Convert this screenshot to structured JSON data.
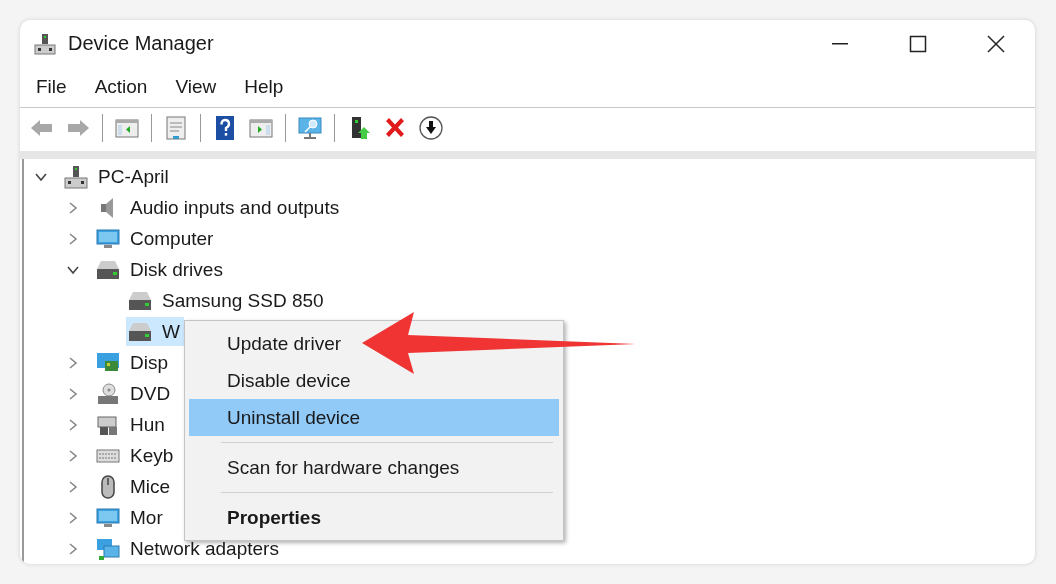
{
  "window": {
    "title": "Device Manager"
  },
  "menu_bar": [
    "File",
    "Action",
    "View",
    "Help"
  ],
  "toolbar": [
    {
      "kind": "back",
      "disabled": true
    },
    {
      "kind": "forward",
      "disabled": true
    },
    {
      "kind": "separator"
    },
    {
      "kind": "panel-left",
      "disabled": false
    },
    {
      "kind": "separator"
    },
    {
      "kind": "properties",
      "disabled": false
    },
    {
      "kind": "separator"
    },
    {
      "kind": "help",
      "disabled": false
    },
    {
      "kind": "panel-right",
      "disabled": false
    },
    {
      "kind": "separator"
    },
    {
      "kind": "scan",
      "disabled": false
    },
    {
      "kind": "separator"
    },
    {
      "kind": "update",
      "disabled": false
    },
    {
      "kind": "uninstall",
      "disabled": false
    },
    {
      "kind": "download",
      "disabled": false
    }
  ],
  "tree": {
    "label": "PC-April",
    "kind": "root",
    "expanded": true,
    "selected": false,
    "children": [
      {
        "label": "Audio inputs and outputs",
        "kind": "audio",
        "expanded": false,
        "selected": false
      },
      {
        "label": "Computer",
        "kind": "computer",
        "expanded": false,
        "selected": false
      },
      {
        "label": "Disk drives",
        "kind": "disk",
        "expanded": true,
        "selected": false,
        "children": [
          {
            "label": "Samsung SSD 850",
            "kind": "disk",
            "selected": false
          },
          {
            "label": "W",
            "kind": "disk",
            "selected": true
          }
        ]
      },
      {
        "label": "Disp",
        "kind": "display",
        "expanded": false,
        "selected": false
      },
      {
        "label": "DVD",
        "kind": "dvd",
        "expanded": false,
        "selected": false
      },
      {
        "label": "Hun",
        "kind": "hid",
        "expanded": false,
        "selected": false
      },
      {
        "label": "Keyb",
        "kind": "keyboard",
        "expanded": false,
        "selected": false
      },
      {
        "label": "Mice",
        "kind": "mouse",
        "expanded": false,
        "selected": false
      },
      {
        "label": "Mor",
        "kind": "computer",
        "expanded": false,
        "selected": false
      },
      {
        "label": "Network adapters",
        "kind": "network",
        "expanded": false,
        "selected": false
      }
    ]
  },
  "context_menu": [
    {
      "kind": "item",
      "label": "Update driver",
      "selected": false,
      "bold": false
    },
    {
      "kind": "item",
      "label": "Disable device",
      "selected": false,
      "bold": false
    },
    {
      "kind": "item",
      "label": "Uninstall device",
      "selected": true,
      "bold": false
    },
    {
      "kind": "separator"
    },
    {
      "kind": "item",
      "label": "Scan for hardware changes",
      "selected": false,
      "bold": false
    },
    {
      "kind": "separator"
    },
    {
      "kind": "item",
      "label": "Properties",
      "selected": false,
      "bold": true
    }
  ]
}
